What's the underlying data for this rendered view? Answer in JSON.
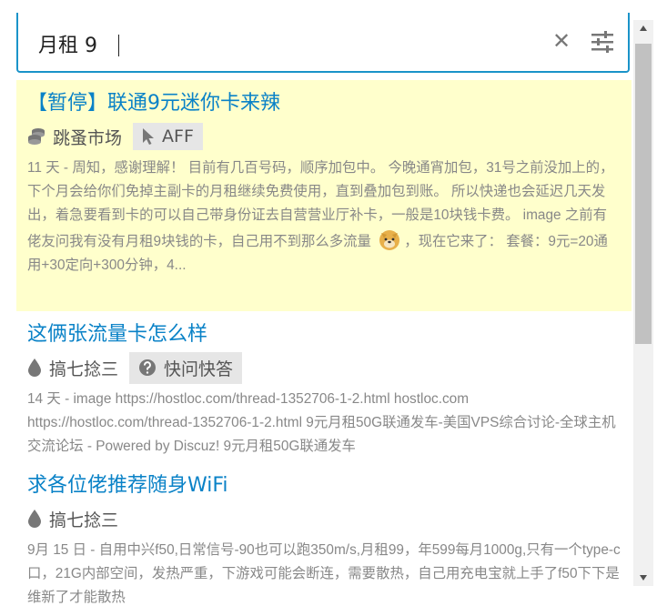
{
  "search": {
    "query": "月租 9"
  },
  "results": [
    {
      "title": "【暂停】联通9元迷你卡来辣",
      "category": "跳蚤市场",
      "category_icon": "coins-icon",
      "tag": "AFF",
      "tag_icon": "cursor-icon",
      "time": "11 天",
      "excerpt_a": " - 周知，感谢理解！ 目前有几百号码，顺序加包中。 今晚通宵加包，31号之前没加上的，下个月会给你们免掉主副卡的月租继续免费使用，直到叠加包到账。 所以快递也会延迟几天发出，着急要看到卡的可以自己带身份证去自营营业厅补卡，一般是10块钱卡费。 image 之前有佬友问我有没有月租9块钱的卡，自己用不到那么多流量",
      "excerpt_b": "，现在它来了： 套餐：9元=20通用+30定向+300分钟，4..."
    },
    {
      "title": "这俩张流量卡怎么样",
      "category": "搞七捻三",
      "category_icon": "drop-icon",
      "tag": "快问快答",
      "tag_icon": "question-circle-icon",
      "time": "14 天",
      "excerpt": " - image https://hostloc.com/thread-1352706-1-2.html hostloc.com https://hostloc.com/thread-1352706-1-2.html 9元月租50G联通发车-美国VPS综合讨论-全球主机交流论坛 - Powered by Discuz! 9元月租50G联通发车"
    },
    {
      "title": "求各位佬推荐随身WiFi",
      "category": "搞七捻三",
      "category_icon": "drop-icon",
      "time": "9月 15 日",
      "excerpt": " - 自用中兴f50,日常信号-90也可以跑350m/s,月租99，年599每月1000g,只有一个type-c口，21G内部空间，发热严重，下游戏可能会断连，需要散热，自己用充电宝就上手了f50下下是维新了才能散热"
    }
  ],
  "colors": {
    "accent": "#1a93c9",
    "link": "#0a82c7",
    "highlight": "#ffffcc"
  }
}
